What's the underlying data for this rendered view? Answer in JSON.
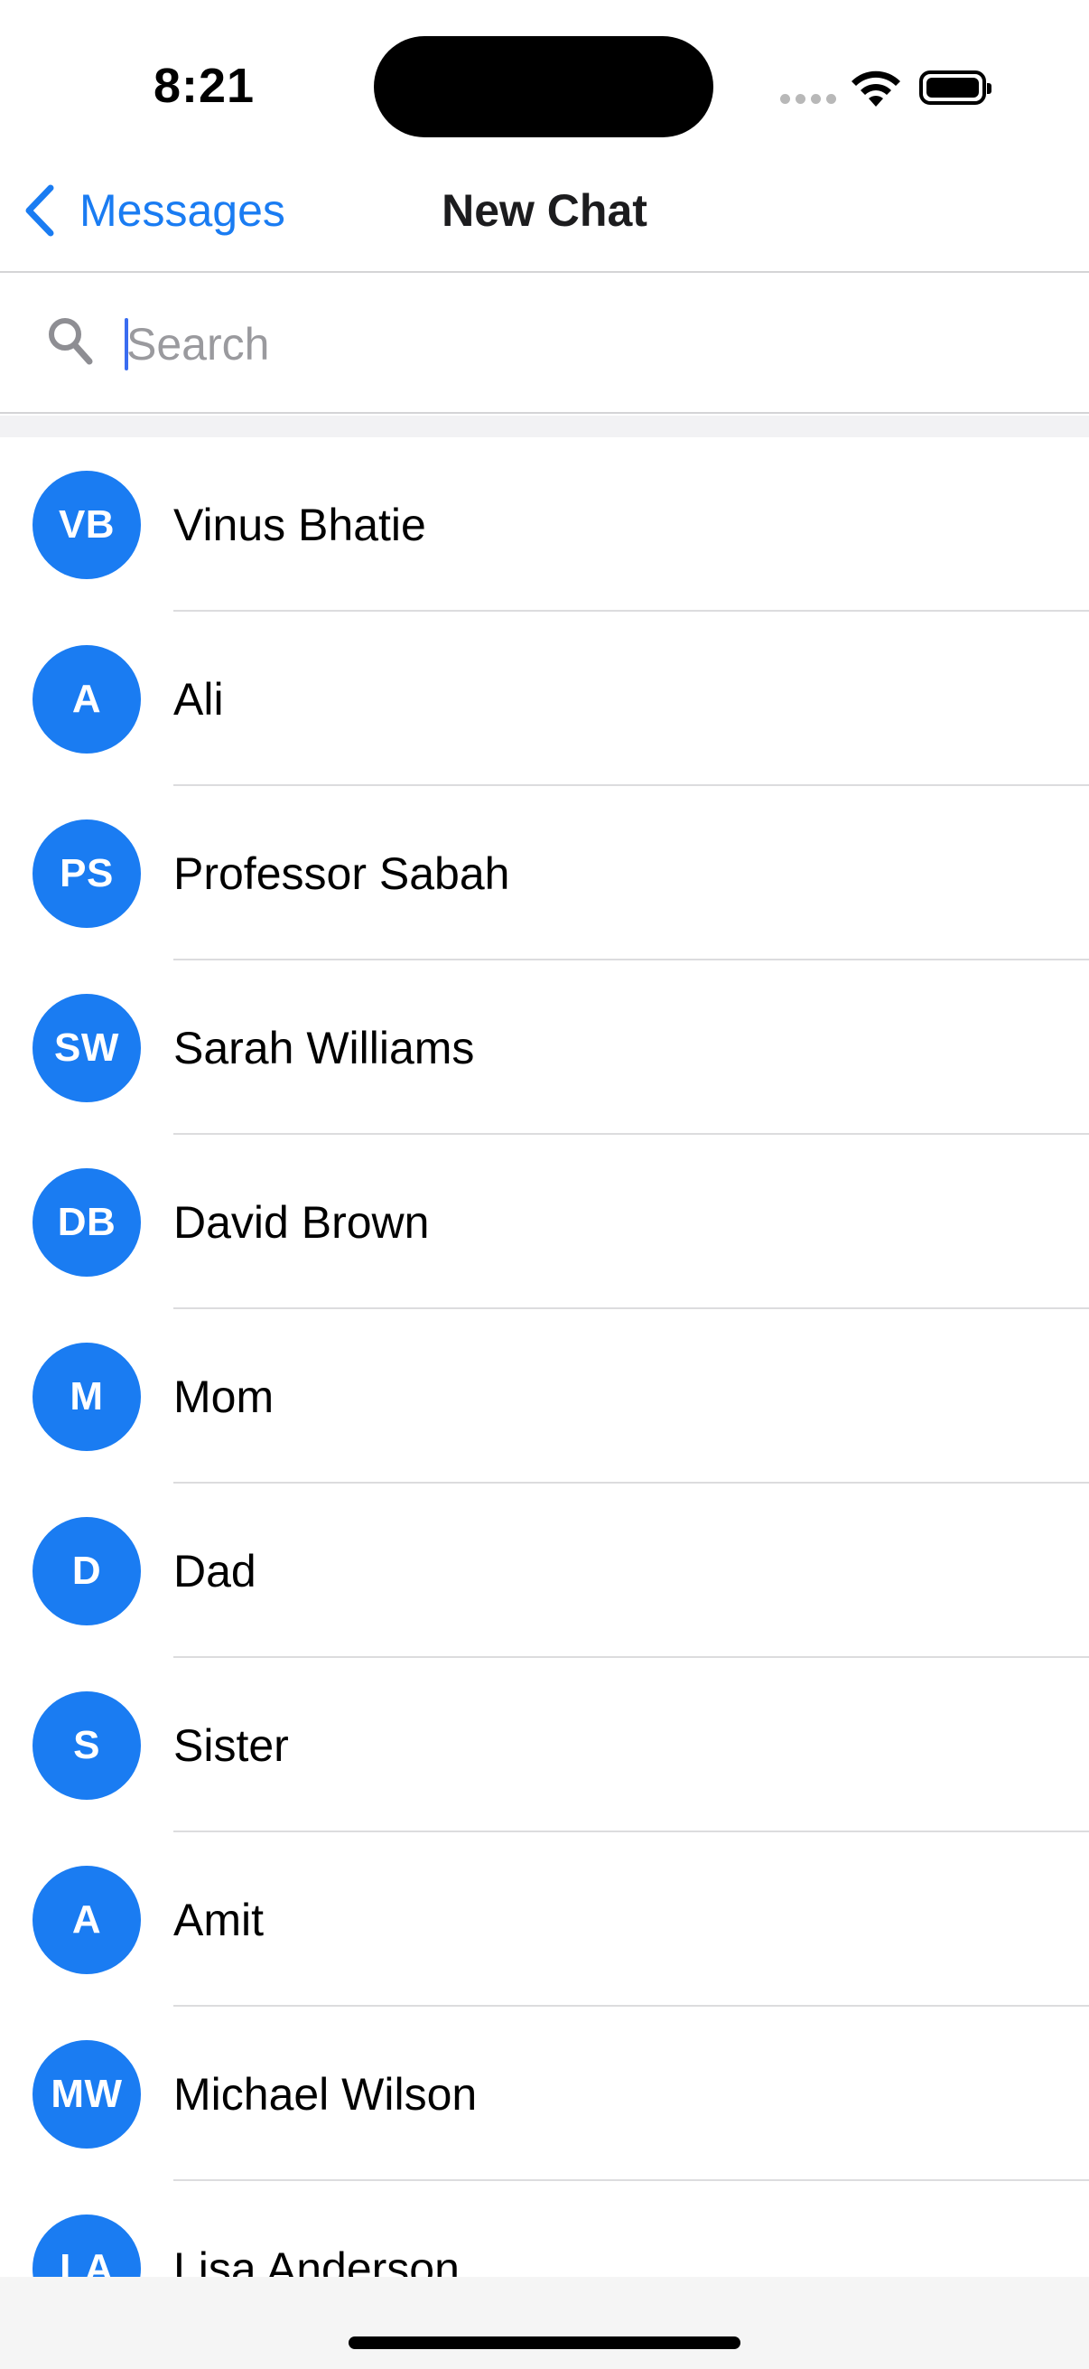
{
  "status_bar": {
    "time": "8:21",
    "signal_icon": "cellular-signal-icon",
    "wifi_icon": "wifi-icon",
    "battery_icon": "battery-full-icon"
  },
  "nav": {
    "back_label": "Messages",
    "back_icon": "chevron-left-icon",
    "title": "New Chat"
  },
  "search": {
    "placeholder": "Search",
    "value": "",
    "icon": "search-icon"
  },
  "colors": {
    "accent": "#1a7cf2",
    "avatar_bg": "#1a7cf2",
    "caret": "#3a6cf0"
  },
  "contacts": [
    {
      "initials": "VB",
      "name": "Vinus Bhatie"
    },
    {
      "initials": "A",
      "name": "Ali"
    },
    {
      "initials": "PS",
      "name": "Professor Sabah"
    },
    {
      "initials": "SW",
      "name": "Sarah Williams"
    },
    {
      "initials": "DB",
      "name": "David Brown"
    },
    {
      "initials": "M",
      "name": "Mom"
    },
    {
      "initials": "D",
      "name": "Dad"
    },
    {
      "initials": "S",
      "name": "Sister"
    },
    {
      "initials": "A",
      "name": "Amit"
    },
    {
      "initials": "MW",
      "name": "Michael Wilson"
    },
    {
      "initials": "LA",
      "name": "Lisa Anderson"
    }
  ]
}
